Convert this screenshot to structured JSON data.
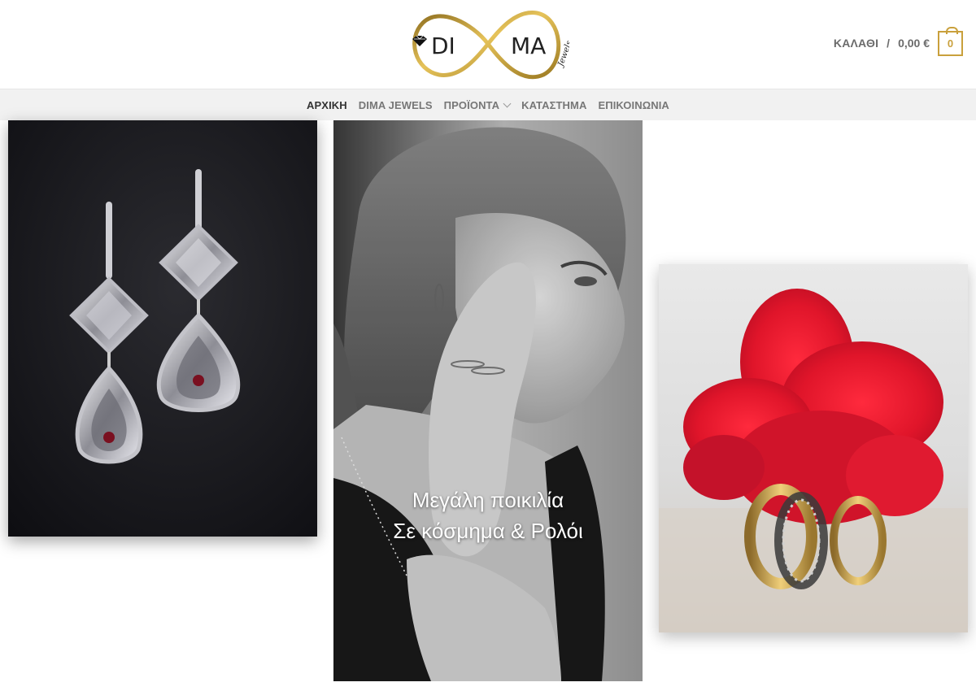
{
  "brand": {
    "logo_left": "DI",
    "logo_right": "MA",
    "logo_script": "Jewels",
    "gold": "#c9a03c"
  },
  "cart": {
    "label": "ΚΑΛΑΘΙ",
    "separator": "/",
    "total": "0,00 €",
    "count": "0",
    "icon": "shopping-bag-icon"
  },
  "nav": {
    "items": [
      {
        "label": "ΑΡΧΙΚΗ",
        "active": true
      },
      {
        "label": "DIMA JEWELS",
        "active": false
      },
      {
        "label": "ΠΡΟΪΟΝΤΑ",
        "active": false,
        "has_dropdown": true
      },
      {
        "label": "ΚΑΤΑΣΤΗΜΑ",
        "active": false
      },
      {
        "label": "ΕΠΙΚΟΙΝΩΝΙΑ",
        "active": false
      }
    ]
  },
  "tiles": {
    "promo": {
      "line1": "Μεγάλη ποικιλία",
      "line2": "Σε κόσμημα & Ρολόι"
    }
  }
}
